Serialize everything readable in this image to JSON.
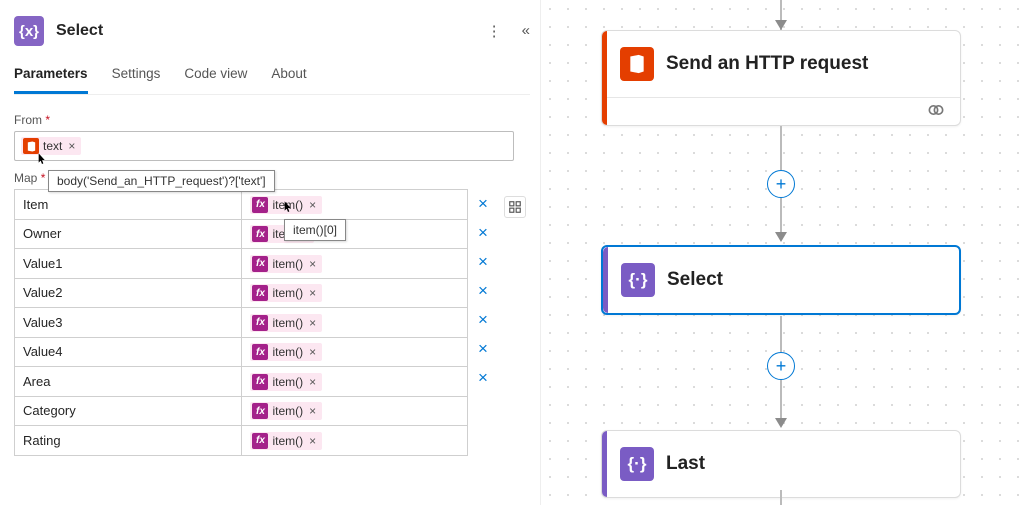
{
  "header": {
    "title": "Select",
    "icon": "{x}"
  },
  "tabs": [
    "Parameters",
    "Settings",
    "Code view",
    "About"
  ],
  "active_tab": 0,
  "labels": {
    "from": "From",
    "map": "Map",
    "required": "*"
  },
  "from_token": {
    "text": "text",
    "tooltip": "body('Send_an_HTTP_request')?['text']"
  },
  "map_rows": [
    {
      "key": "Item",
      "expr": "item()",
      "tooltip": "item()[0]"
    },
    {
      "key": "Owner",
      "expr": "item"
    },
    {
      "key": "Value1",
      "expr": "item()"
    },
    {
      "key": "Value2",
      "expr": "item()"
    },
    {
      "key": "Value3",
      "expr": "item()"
    },
    {
      "key": "Value4",
      "expr": "item()"
    },
    {
      "key": "Area",
      "expr": "item()"
    },
    {
      "key": "Category",
      "expr": "item()"
    },
    {
      "key": "Rating",
      "expr": "item()"
    }
  ],
  "delete_glyph": "×",
  "fx_glyph": "fx",
  "canvas": {
    "nodes": [
      {
        "id": "http",
        "title": "Send an HTTP request",
        "accent": "#e43e00",
        "has_link_footer": true
      },
      {
        "id": "select",
        "title": "Select",
        "accent": "#7a5cc4",
        "selected": true
      },
      {
        "id": "last",
        "title": "Last",
        "accent": "#7a5cc4"
      }
    ],
    "add_glyph": "+"
  }
}
